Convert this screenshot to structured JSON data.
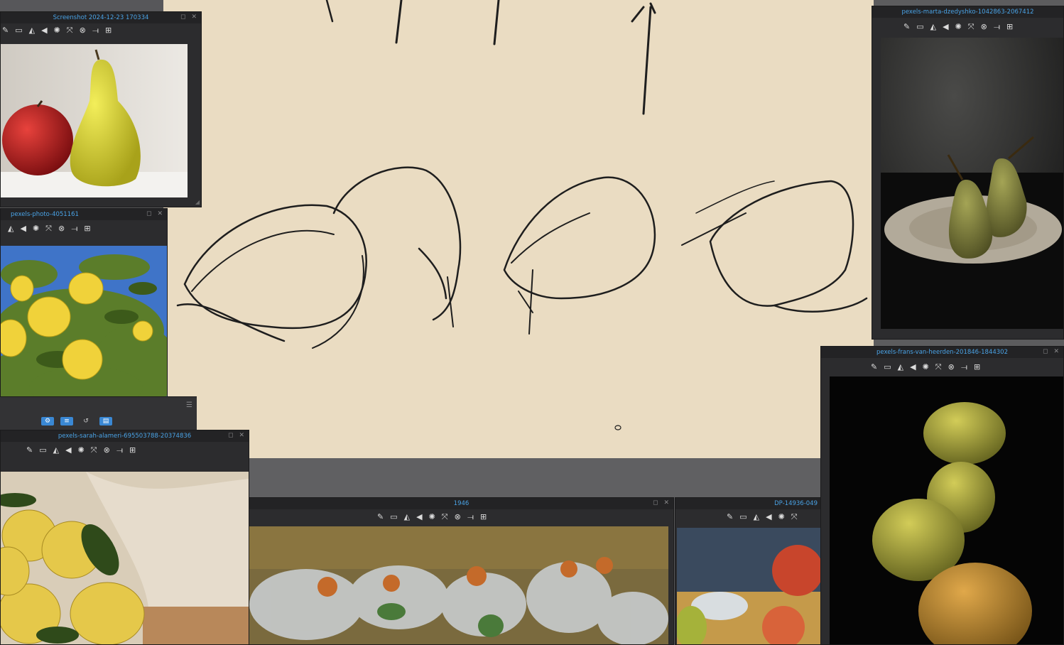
{
  "app": {
    "canvas_color": "#eadcc2",
    "accent": "#4aa3e6"
  },
  "panels": [
    {
      "id": "p1",
      "title": "Screenshot 2024-12-23 170334",
      "icons": [
        "pen-icon",
        "rect-icon",
        "contrast-icon",
        "flip-icon",
        "color-icon",
        "expand-icon",
        "gray-icon",
        "line-icon",
        "grid-icon"
      ]
    },
    {
      "id": "p2",
      "title": "pexels-photo-4051161",
      "icons": [
        "contrast-icon",
        "flip-icon",
        "color-icon",
        "expand-icon",
        "gray-icon",
        "line-icon",
        "grid-icon"
      ]
    },
    {
      "id": "p3",
      "title": "pexels-sarah-alameri-695503788-20374836",
      "icons": [
        "pen-icon",
        "rect-icon",
        "contrast-icon",
        "flip-icon",
        "color-icon",
        "expand-icon",
        "gray-icon",
        "line-icon",
        "grid-icon"
      ]
    },
    {
      "id": "p4",
      "title": "1946",
      "icons": [
        "pen-icon",
        "rect-icon",
        "contrast-icon",
        "flip-icon",
        "color-icon",
        "expand-icon",
        "gray-icon",
        "line-icon",
        "grid-icon"
      ]
    },
    {
      "id": "p5",
      "title": "DP-14936-049",
      "icons": [
        "pen-icon",
        "rect-icon",
        "contrast-icon",
        "flip-icon",
        "color-icon",
        "expand-icon"
      ]
    },
    {
      "id": "p6",
      "title": "pexels-marta-dzedyshko-1042863-2067412",
      "icons": [
        "pen-icon",
        "rect-icon",
        "contrast-icon",
        "flip-icon",
        "color-icon",
        "expand-icon",
        "gray-icon",
        "line-icon",
        "grid-icon"
      ]
    },
    {
      "id": "p7",
      "title": "pexels-frans-van-heerden-201846-1844302",
      "icons": [
        "pen-icon",
        "rect-icon",
        "contrast-icon",
        "flip-icon",
        "color-icon",
        "expand-icon",
        "gray-icon",
        "line-icon",
        "grid-icon"
      ]
    }
  ],
  "icon_glyphs": {
    "pen-icon": "✎",
    "rect-icon": "▭",
    "contrast-icon": "◭",
    "flip-icon": "◀",
    "color-icon": "✺",
    "expand-icon": "⤧",
    "gray-icon": "⊗",
    "line-icon": "⟞",
    "grid-icon": "⊞"
  },
  "window_controls": {
    "maximize": "◻",
    "close": "✕"
  },
  "mini_toolbar": [
    "settings-icon",
    "filter-icon",
    "undo-icon",
    "layers-icon"
  ],
  "mini_toolbar_glyphs": {
    "settings-icon": "⚙",
    "filter-icon": "≡",
    "undo-icon": "↺",
    "layers-icon": "▤"
  }
}
